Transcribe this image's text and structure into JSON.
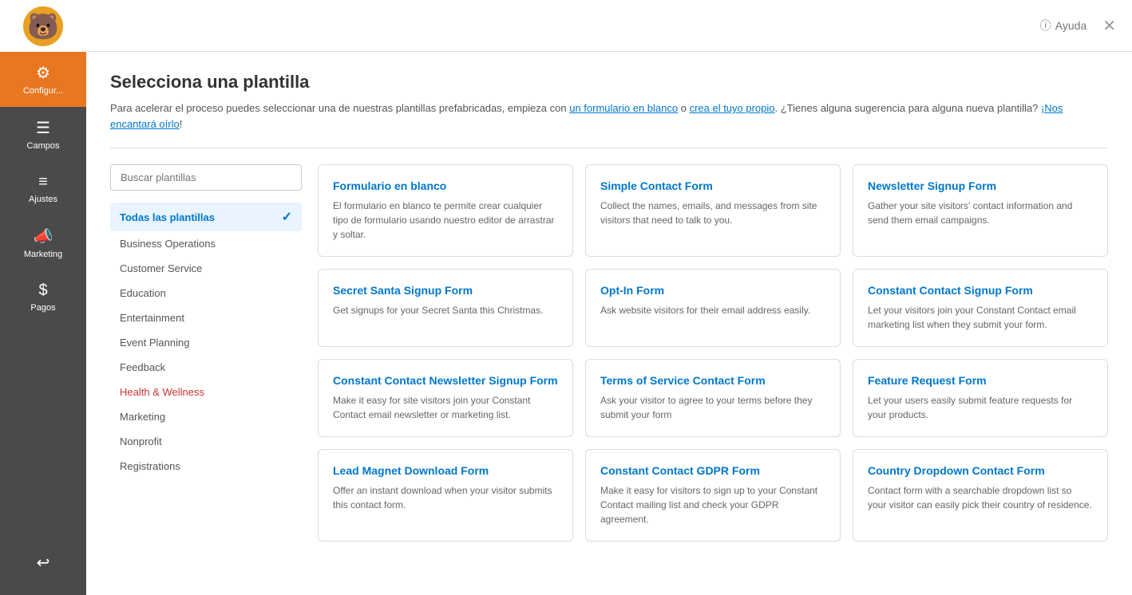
{
  "topbar": {
    "help_label": "Ayuda",
    "close_icon": "✕"
  },
  "page": {
    "title": "Selecciona una plantilla",
    "description_prefix": "Para acelerar el proceso puedes seleccionar una de nuestras plantillas prefabricadas, empieza con ",
    "link_blank": "un formulario en blanco",
    "description_middle": " o ",
    "link_custom": "crea el tuyo propio",
    "description_suffix": ". ¿Tienes alguna sugerencia para alguna nueva plantilla? ",
    "link_feedback": "¡Nos encantará oírlo",
    "description_end": "!"
  },
  "search": {
    "placeholder": "Buscar plantillas"
  },
  "filters": [
    {
      "id": "all",
      "label": "Todas las plantillas",
      "active": true
    },
    {
      "id": "business",
      "label": "Business Operations",
      "active": false
    },
    {
      "id": "customer",
      "label": "Customer Service",
      "active": false
    },
    {
      "id": "education",
      "label": "Education",
      "active": false
    },
    {
      "id": "entertainment",
      "label": "Entertainment",
      "active": false
    },
    {
      "id": "event",
      "label": "Event Planning",
      "active": false
    },
    {
      "id": "feedback",
      "label": "Feedback",
      "active": false
    },
    {
      "id": "health",
      "label": "Health & Wellness",
      "active": false,
      "special": true
    },
    {
      "id": "marketing",
      "label": "Marketing",
      "active": false
    },
    {
      "id": "nonprofit",
      "label": "Nonprofit",
      "active": false
    },
    {
      "id": "registrations",
      "label": "Registrations",
      "active": false
    }
  ],
  "templates": [
    {
      "title": "Formulario en blanco",
      "description": "El formulario en blanco te permite crear cualquier tipo de formulario usando nuestro editor de arrastrar y soltar."
    },
    {
      "title": "Simple Contact Form",
      "description": "Collect the names, emails, and messages from site visitors that need to talk to you."
    },
    {
      "title": "Newsletter Signup Form",
      "description": "Gather your site visitors' contact information and send them email campaigns."
    },
    {
      "title": "Secret Santa Signup Form",
      "description": "Get signups for your Secret Santa this Christmas."
    },
    {
      "title": "Opt-In Form",
      "description": "Ask website visitors for their email address easily."
    },
    {
      "title": "Constant Contact Signup Form",
      "description": "Let your visitors join your Constant Contact email marketing list when they submit your form."
    },
    {
      "title": "Constant Contact Newsletter Signup Form",
      "description": "Make it easy for site visitors join your Constant Contact email newsletter or marketing list."
    },
    {
      "title": "Terms of Service Contact Form",
      "description": "Ask your visitor to agree to your terms before they submit your form"
    },
    {
      "title": "Feature Request Form",
      "description": "Let your users easily submit feature requests for your products."
    },
    {
      "title": "Lead Magnet Download Form",
      "description": "Offer an instant download when your visitor submits this contact form."
    },
    {
      "title": "Constant Contact GDPR Form",
      "description": "Make it easy for visitors to sign up to your Constant Contact mailing list and check your GDPR agreement."
    },
    {
      "title": "Country Dropdown Contact Form",
      "description": "Contact form with a searchable dropdown list so your visitor can easily pick their country of residence."
    }
  ],
  "sidebar": {
    "items": [
      {
        "id": "configurar",
        "label": "Configur...",
        "icon": "⚙",
        "active": true
      },
      {
        "id": "campos",
        "label": "Campos",
        "icon": "☰",
        "active": false
      },
      {
        "id": "ajustes",
        "label": "Ajustes",
        "icon": "≡",
        "active": false
      },
      {
        "id": "marketing",
        "label": "Marketing",
        "icon": "📣",
        "active": false
      },
      {
        "id": "pagos",
        "label": "Pagos",
        "icon": "$",
        "active": false
      }
    ],
    "bottom_icon": "↩"
  }
}
